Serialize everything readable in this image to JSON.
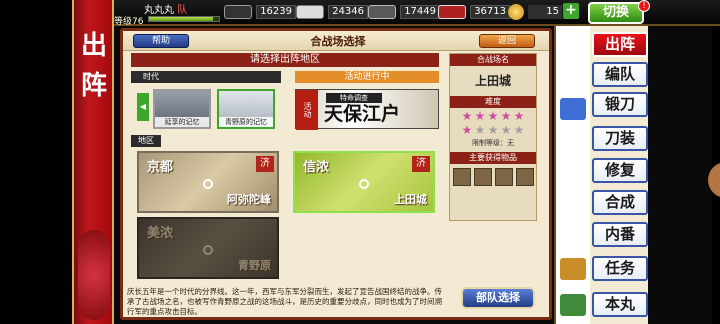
{
  "banner": {
    "chars": [
      "出",
      "阵"
    ]
  },
  "status": {
    "team_name": "丸丸丸",
    "team_suffix": "队",
    "level_label": "等级76",
    "exp_fraction": 0.92,
    "resources": [
      {
        "icon": "charcoal-icon",
        "value": "16239"
      },
      {
        "icon": "steel-icon",
        "value": "24346"
      },
      {
        "icon": "coolant-icon",
        "value": "17449"
      },
      {
        "icon": "whetstone-icon",
        "value": "36713"
      }
    ],
    "coins": "15",
    "plus": "+",
    "switch_label": "切换",
    "alert": "!"
  },
  "panel": {
    "help": "帮助",
    "title": "合战场选择",
    "back": "返回",
    "instruction": "请选择出阵地区",
    "era_label": "时代",
    "event_label": "活动进行中",
    "era_arrow": "◀",
    "eras": [
      {
        "label": "延享的记忆"
      },
      {
        "label": "青野原的记忆"
      }
    ],
    "event": {
      "tag": "活动",
      "small": "特命调查",
      "big": "天保江户"
    },
    "region_label": "地区",
    "maps": [
      {
        "name": "京都",
        "castle": "阿弥陀峰",
        "badge": "济"
      },
      {
        "name": "信浓",
        "castle": "上田城",
        "badge": "济"
      },
      {
        "name": "美浓",
        "castle": "青野原",
        "badge": ""
      }
    ],
    "description": "庆长五年是一个时代的分界线。这一年，西军与东军分裂而生，发起了宣告战国终结的战争。传承了古战场之名，也被写作青野原之战的这场战斗，是历史的重要分歧点，同时也成为了时间溯行军的重点攻击目标。",
    "team_button": "部队选择",
    "side": {
      "name_header": "合战场名",
      "castle": "上田城",
      "difficulty_header": "难度",
      "stars_on": 6,
      "stars_total": 10,
      "limit_label": "限制等级：无",
      "drops_header": "主要获得物品"
    }
  },
  "menu": [
    {
      "label": "出阵",
      "active": true
    },
    {
      "label": "编队",
      "active": false
    },
    {
      "label": "锻刀",
      "active": false
    },
    {
      "label": "刀装",
      "active": false
    },
    {
      "label": "修复",
      "active": false
    },
    {
      "label": "合成",
      "active": false
    },
    {
      "label": "内番",
      "active": false
    },
    {
      "label": "任务",
      "active": false
    },
    {
      "label": "本丸",
      "active": false
    }
  ]
}
